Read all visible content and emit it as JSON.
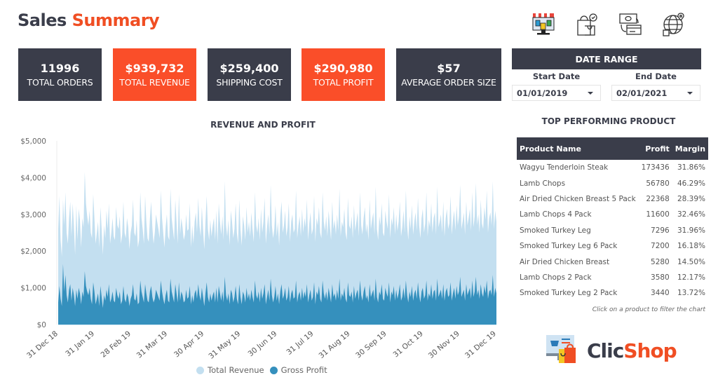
{
  "header": {
    "title_part1": "Sales",
    "title_part2": "Summary",
    "icons": [
      "storefront-icon",
      "shopping-bags-icon",
      "payment-exchange-icon",
      "global-delivery-icon"
    ]
  },
  "kpis": [
    {
      "value": "11996",
      "label": "TOTAL ORDERS",
      "style": "dark"
    },
    {
      "value": "$939,732",
      "label": "TOTAL REVENUE",
      "style": "orange"
    },
    {
      "value": "$259,400",
      "label": "SHIPPING COST",
      "style": "dark"
    },
    {
      "value": "$290,980",
      "label": "TOTAL PROFIT",
      "style": "orange"
    },
    {
      "value": "$57",
      "label": "AVERAGE ORDER SIZE",
      "style": "dark"
    }
  ],
  "date_range": {
    "title": "DATE RANGE",
    "start_label": "Start Date",
    "end_label": "End Date",
    "start_value": "01/01/2019",
    "end_value": "02/01/2021"
  },
  "colors": {
    "dark": "#3a3d4a",
    "accent": "#fa4e29",
    "revenue": "#c3dff0",
    "profit": "#3590bd"
  },
  "chart_data": {
    "type": "area",
    "title": "REVENUE AND PROFIT",
    "xlabel": "",
    "ylabel": "",
    "ylim": [
      0,
      5000
    ],
    "yticks": [
      "$0",
      "$1,000",
      "$2,000",
      "$3,000",
      "$4,000",
      "$5,000"
    ],
    "ytick_values": [
      0,
      1000,
      2000,
      3000,
      4000,
      5000
    ],
    "xticks": [
      "31 Dec 18",
      "31 Jan 19",
      "28 Feb 19",
      "31 Mar 19",
      "30 Apr 19",
      "31 May 19",
      "30 Jun 19",
      "31 Jul 19",
      "31 Aug 19",
      "30 Sep 19",
      "31 Oct 19",
      "30 Nov 19",
      "31 Dec 19"
    ],
    "x_range": [
      "2018-12-31",
      "2019-12-31"
    ],
    "grid": false,
    "legend_position": "bottom",
    "series": [
      {
        "name": "Total Revenue",
        "color": "#c3dff0",
        "approx_daily_range": [
          1800,
          4150
        ],
        "approx_typical": 2600,
        "values": [
          2600,
          3500,
          2300,
          1850,
          3400,
          2700,
          3600,
          2500,
          2200,
          2900,
          3350,
          2400,
          3300,
          2700,
          1900,
          3250,
          2300,
          3150,
          2850,
          2100,
          2900,
          2650,
          4150,
          3300,
          2950,
          2700,
          3100,
          2500,
          2350,
          3550,
          2900,
          2200,
          2500,
          2800,
          2100,
          3200,
          2600,
          1900,
          2700,
          2350,
          3100,
          2600,
          3300,
          2200,
          2500,
          2900,
          2400,
          2300,
          3200,
          2700,
          2600,
          2950,
          2200,
          2450,
          3350,
          2500,
          2350,
          2900,
          2650,
          2050,
          2500,
          2700,
          3400,
          2500,
          2400,
          2850,
          2100,
          2300,
          3600,
          2900,
          2600,
          2200,
          3500,
          2800,
          2350,
          2250,
          2900,
          3350,
          2650,
          2200,
          2500,
          3000,
          2800,
          2600,
          2350,
          3650,
          2900,
          2500,
          2100,
          2650,
          3000,
          2400,
          2300,
          3700,
          2900,
          2600,
          2300,
          3400,
          2800,
          2200,
          3550,
          2450,
          2900,
          2650,
          2300,
          2450,
          3000,
          2550,
          2600,
          3300,
          2100,
          2700,
          2200,
          2800,
          3050,
          2500,
          3450,
          2700,
          2400,
          3200,
          2600,
          2050,
          2800,
          3500,
          2600,
          2300,
          2850,
          2400,
          2700,
          2900,
          2300,
          3100,
          2200,
          3300,
          2800,
          2450,
          2950,
          2300,
          3900,
          2700,
          2400,
          2850,
          2150,
          3100,
          2800,
          2350,
          2600,
          3300,
          2500,
          2200,
          3400,
          2600,
          2150,
          2950,
          2700,
          2300,
          3200,
          2500,
          2800,
          2400,
          3050,
          2600,
          2250,
          3600,
          2700,
          2500,
          2900,
          2300,
          3150,
          2500,
          2800,
          3450,
          2200,
          2650,
          3000,
          2450,
          3800,
          2700,
          2350,
          2600,
          3250,
          2400,
          2800,
          2150,
          2950,
          3350,
          2500,
          2700,
          3100,
          2400,
          2650,
          3300,
          2250,
          2800,
          3000,
          2500,
          2600,
          3650,
          2350,
          2700,
          2950,
          2400,
          3150,
          2500,
          2900,
          2650,
          3400,
          2300,
          2750,
          3050,
          2450,
          2600,
          3500,
          2250,
          2900,
          2700,
          3200,
          2500,
          2350,
          3600,
          2800,
          2550,
          2950,
          2400,
          3100,
          2700,
          2300,
          3350,
          2600,
          2850,
          2450,
          3000,
          2550,
          3700,
          2400,
          2800,
          2650,
          3150,
          2500,
          2300,
          3450,
          2700,
          2600,
          2950,
          2350,
          3250,
          2550,
          2800,
          3050,
          2400,
          3600,
          2700,
          2450,
          2900,
          3200,
          2500,
          2750,
          2300,
          3400,
          2600,
          2850,
          3050,
          2450,
          3750,
          2600,
          2300,
          2950,
          2700,
          3300,
          2500,
          2400,
          3100,
          2800,
          2600,
          3550,
          2350,
          2900,
          2700,
          3200,
          2450,
          3000,
          2550,
          2800,
          3350,
          2400,
          2650,
          3100,
          2500,
          3650,
          2700,
          2300,
          2950,
          2600,
          3250,
          2450,
          2800,
          3050,
          2550,
          3450,
          2700,
          2350,
          2900,
          3150,
          2500,
          2750,
          3600,
          2400,
          2850,
          2650,
          3300,
          2500,
          2900,
          3050,
          2450,
          3750,
          2650,
          2800,
          3000,
          2500,
          3350,
          2400,
          2900,
          3150,
          2600,
          2750,
          3500,
          2450,
          2850,
          3100,
          2550,
          3250,
          2700,
          2950,
          3800,
          2600,
          2800,
          3050,
          2450,
          3350,
          2700,
          2900,
          3150,
          2550,
          3600,
          2650,
          2950,
          3850,
          2700,
          3000,
          2500,
          3400,
          2750,
          2600,
          3200,
          2850,
          3650,
          2500,
          2900,
          3050,
          2700,
          3900,
          2600,
          3100,
          2800
        ]
      },
      {
        "name": "Gross Profit",
        "color": "#3590bd",
        "approx_daily_range": [
          300,
          1650
        ],
        "approx_typical": 650,
        "values": [
          600,
          1050,
          700,
          500,
          1650,
          900,
          1350,
          800,
          600,
          950,
          1100,
          650,
          1000,
          800,
          500,
          950,
          700,
          1000,
          850,
          550,
          900,
          750,
          1450,
          1050,
          900,
          800,
          1000,
          700,
          550,
          1150,
          900,
          550,
          700,
          850,
          500,
          1050,
          750,
          450,
          800,
          650,
          950,
          750,
          1100,
          600,
          700,
          900,
          650,
          600,
          1000,
          800,
          700,
          900,
          550,
          650,
          1050,
          700,
          600,
          850,
          750,
          500,
          700,
          800,
          1100,
          700,
          650,
          850,
          550,
          600,
          1200,
          900,
          750,
          600,
          1100,
          850,
          650,
          600,
          900,
          1050,
          750,
          600,
          700,
          950,
          850,
          750,
          650,
          1200,
          900,
          700,
          550,
          800,
          950,
          650,
          600,
          1250,
          900,
          750,
          600,
          1100,
          850,
          600,
          1150,
          650,
          900,
          800,
          600,
          650,
          950,
          700,
          750,
          1050,
          550,
          800,
          600,
          850,
          950,
          700,
          1100,
          800,
          650,
          1000,
          750,
          500,
          850,
          1150,
          750,
          600,
          850,
          650,
          800,
          900,
          600,
          1000,
          600,
          1050,
          850,
          650,
          900,
          600,
          1300,
          800,
          650,
          850,
          550,
          950,
          850,
          600,
          750,
          1050,
          700,
          550,
          1100,
          750,
          550,
          900,
          800,
          600,
          1000,
          700,
          850,
          650,
          950,
          750,
          600,
          1200,
          800,
          700,
          900,
          600,
          1000,
          700,
          850,
          1100,
          550,
          750,
          950,
          650,
          1250,
          800,
          600,
          750,
          1050,
          650,
          850,
          550,
          900,
          1100,
          700,
          800,
          1000,
          650,
          750,
          1050,
          600,
          850,
          950,
          700,
          750,
          1200,
          600,
          800,
          900,
          650,
          1000,
          700,
          900,
          750,
          1100,
          600,
          800,
          950,
          650,
          750,
          1150,
          550,
          900,
          800,
          1050,
          700,
          600,
          1200,
          850,
          700,
          900,
          650,
          1000,
          800,
          600,
          1100,
          750,
          850,
          650,
          950,
          700,
          1250,
          650,
          850,
          750,
          1000,
          700,
          600,
          1150,
          800,
          750,
          900,
          600,
          1050,
          700,
          850,
          950,
          650,
          1200,
          800,
          650,
          900,
          1050,
          700,
          800,
          600,
          1100,
          750,
          850,
          950,
          650,
          1250,
          750,
          600,
          900,
          800,
          1100,
          700,
          650,
          1000,
          850,
          750,
          1150,
          600,
          900,
          800,
          1050,
          650,
          950,
          700,
          850,
          1100,
          650,
          750,
          1000,
          700,
          1200,
          800,
          600,
          900,
          750,
          1050,
          650,
          850,
          950,
          700,
          1150,
          800,
          600,
          900,
          1000,
          700,
          800,
          1200,
          650,
          850,
          750,
          1100,
          700,
          900,
          950,
          650,
          1250,
          750,
          850,
          950,
          700,
          1100,
          650,
          900,
          1000,
          750,
          800,
          1150,
          650,
          850,
          1000,
          700,
          1050,
          800,
          900,
          1300,
          750,
          850,
          950,
          650,
          1100,
          800,
          900,
          1000,
          700,
          1200,
          750,
          900,
          1300,
          800,
          950,
          700,
          1100,
          850,
          750,
          1050,
          850,
          1200,
          700,
          900,
          950,
          800,
          1350,
          750,
          1000,
          850
        ]
      }
    ]
  },
  "table": {
    "title": "TOP PERFORMING PRODUCT",
    "columns": [
      "Product Name",
      "Profit",
      "Margin"
    ],
    "rows": [
      {
        "name": "Wagyu Tenderloin Steak",
        "profit": "173436",
        "margin": "31.86%"
      },
      {
        "name": "Lamb Chops",
        "profit": "56780",
        "margin": "46.29%"
      },
      {
        "name": "Air Dried Chicken Breast 5 Pack",
        "profit": "22368",
        "margin": "28.39%"
      },
      {
        "name": "Lamb Chops 4 Pack",
        "profit": "11600",
        "margin": "32.46%"
      },
      {
        "name": "Smoked Turkey Leg",
        "profit": "7296",
        "margin": "31.96%"
      },
      {
        "name": "Smoked Turkey Leg 6 Pack",
        "profit": "7200",
        "margin": "16.18%"
      },
      {
        "name": "Air Dried Chicken Breast",
        "profit": "5280",
        "margin": "14.50%"
      },
      {
        "name": "Lamb Chops 2 Pack",
        "profit": "3580",
        "margin": "12.17%"
      },
      {
        "name": "Smoked Turkey Leg 2 Pack",
        "profit": "3440",
        "margin": "13.72%"
      }
    ],
    "footnote": "Click on a product to filter the chart"
  },
  "logo": {
    "part1": "Clic",
    "part2": "Shop"
  }
}
